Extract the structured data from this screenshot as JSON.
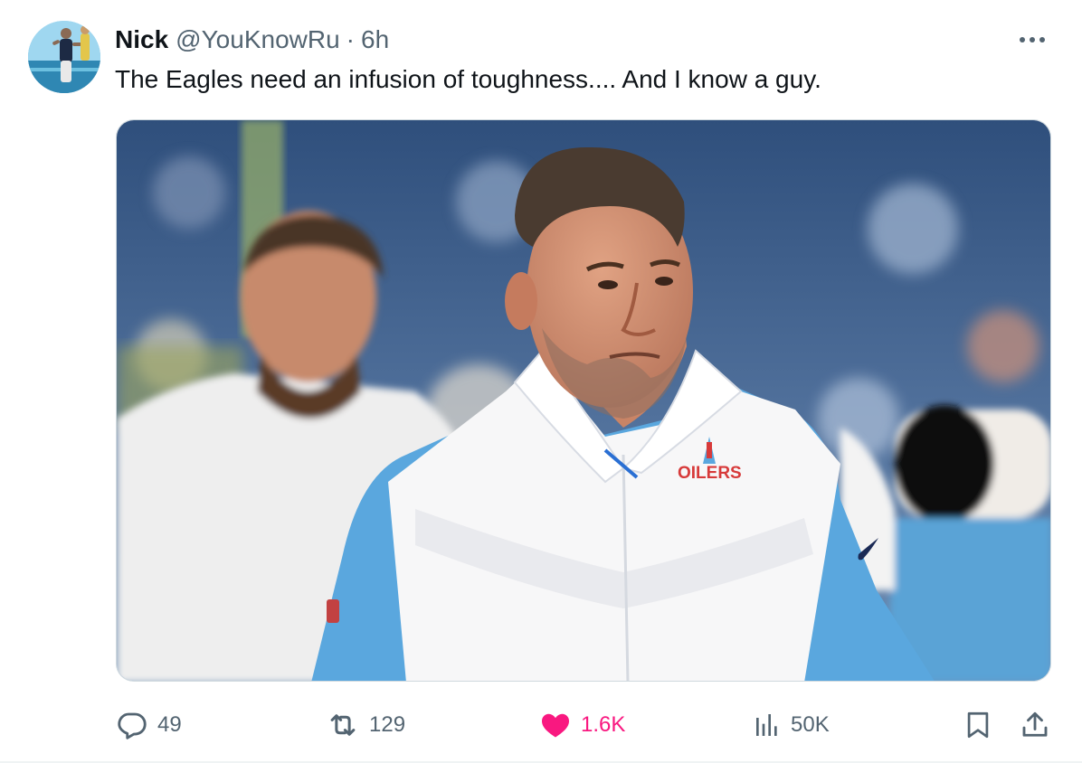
{
  "tweet": {
    "author_name": "Nick",
    "author_handle": "@YouKnowRu",
    "separator": "·",
    "timestamp": "6h",
    "text": "The Eagles need an infusion of toughness.... And I know a guy.",
    "image_text": "OILERS"
  },
  "actions": {
    "replies": "49",
    "retweets": "129",
    "likes": "1.6K",
    "views": "50K"
  },
  "colors": {
    "like_active": "#f91880",
    "secondary_text": "#536471",
    "primary_text": "#0f1419",
    "border": "#cfd9de"
  },
  "icons": {
    "more": "more-horizontal-icon",
    "reply": "reply-icon",
    "retweet": "retweet-icon",
    "like": "heart-filled-icon",
    "views": "views-bar-chart-icon",
    "bookmark": "bookmark-icon",
    "share": "share-icon"
  }
}
